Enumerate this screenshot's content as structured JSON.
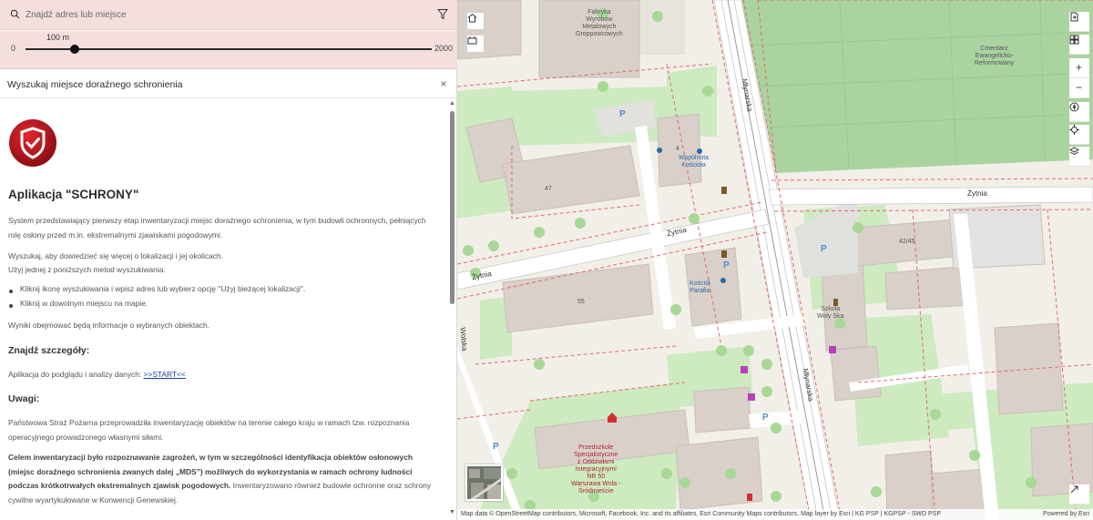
{
  "search": {
    "placeholder": "Znajdź adres lub miejsce",
    "icon": "search-icon",
    "filter_icon": "filter-icon"
  },
  "slider": {
    "value_label": "100 m",
    "min_label": "0",
    "max_label": "2000",
    "min": 0,
    "max": 2000,
    "value": 100
  },
  "panel": {
    "title": "Wyszukaj miejsce doraźnego schronienia",
    "close_label": "×",
    "app_title": "Aplikacja \"SCHRONY\"",
    "p1": "System przedstawiający pierwszy etap inwentaryzacji miejsc doraźnego schronienia, w tym budowli ochronnych, pełniących rolę osłony przed m.in. ekstremalnymi zjawiskami pogodowymi.",
    "p2": "Wyszukaj, aby dowiedzieć się więcej o lokalizacji i jej okolicach.",
    "p2b": "Użyj jednej z poniższych metod wyszukiwania:",
    "bullet1": "Kliknij ikonę wyszukiwania i wpisz adres lub wybierz opcję \"Użyj bieżącej lokalizacji\".",
    "bullet2": "Kliknij w dowolnym miejscu na mapie.",
    "p3": "Wyniki obejmować będą informacje o wybranych obiektach.",
    "h_details": "Znajdź szczegóły:",
    "p4_prefix": "Aplikacja do podglądu i analizy danych: ",
    "p4_link": ">>START<<",
    "h_notes": "Uwagi:",
    "p5": "Państwowa Straż Pożarna przeprowadziła inwentaryzację obiektów na terenie całego kraju w ramach tzw. rozpoznania operacyjnego prowadzonego własnymi siłami.",
    "p6_a": "Celem inwentaryzacji było rozpoznawanie zagrożeń, w tym w szczególności identyfikacja obiektów osłonowych (miejsc doraźnego schronienia zwanych dalej „MDS”) możliwych do wykorzystania w ramach ochrony ludności podczas krótkotrwałych ekstremalnych zjawisk pogodowych.",
    "p6_b": " Inwentaryzowano również budowle ochronne oraz schrony cywilne wyartykułowane w Konwencji Genewskiej."
  },
  "map": {
    "streets": {
      "zytnia_left": "Żytnia",
      "zytnia_mid": "Żytnia",
      "zytnia_right": "Żytnia",
      "wolska_top": "Młynarska",
      "wolska_bottom": "Młynarska",
      "side": "Wolska"
    },
    "labels": {
      "factory": "Fabryka\nWyrobów\nMetalowych\nGroppowcowych",
      "cemetery": "Cmentarz\nEwangelicko-\nReformowany",
      "church": "Wspólnota\nKościoła",
      "preschool": "Kościół\nParafia",
      "school": "Przedszkole\nSpecjalistyczne\nz Oddziałami\nIntegracyjnymi\nNR 50\nWarszawa Wola -\nŚródmieście",
      "culture": "Szkoła\nWoly Ska",
      "n47": "47",
      "n55": "55",
      "n4": "4",
      "n42": "42/45"
    },
    "parking": "P",
    "attribution": "Map data © OpenStreetMap contributors, Microsoft, Facebook, Inc. and its affiliates, Esri Community Maps contributors, Map layer by Esri | KG PSP | KGPSP - SWD PSP",
    "powered": "Powered by Esri",
    "colors": {
      "land": "#f2efe9",
      "park": "#cdeac0",
      "cemetery": "#aad3a0",
      "building": "#d9d0c9",
      "road": "#ffffff",
      "boundary": "#e26a6a",
      "accent": "#c0181f"
    }
  },
  "controls": {
    "home_icon": "home-icon",
    "layers_icon": "basemap-icon",
    "right": [
      "export-icon",
      "grid-icon",
      "zoom-in-icon",
      "zoom-out-icon",
      "compass-icon",
      "locate-icon",
      "layer-list-icon"
    ],
    "zoom_in": "+",
    "zoom_out": "−"
  }
}
